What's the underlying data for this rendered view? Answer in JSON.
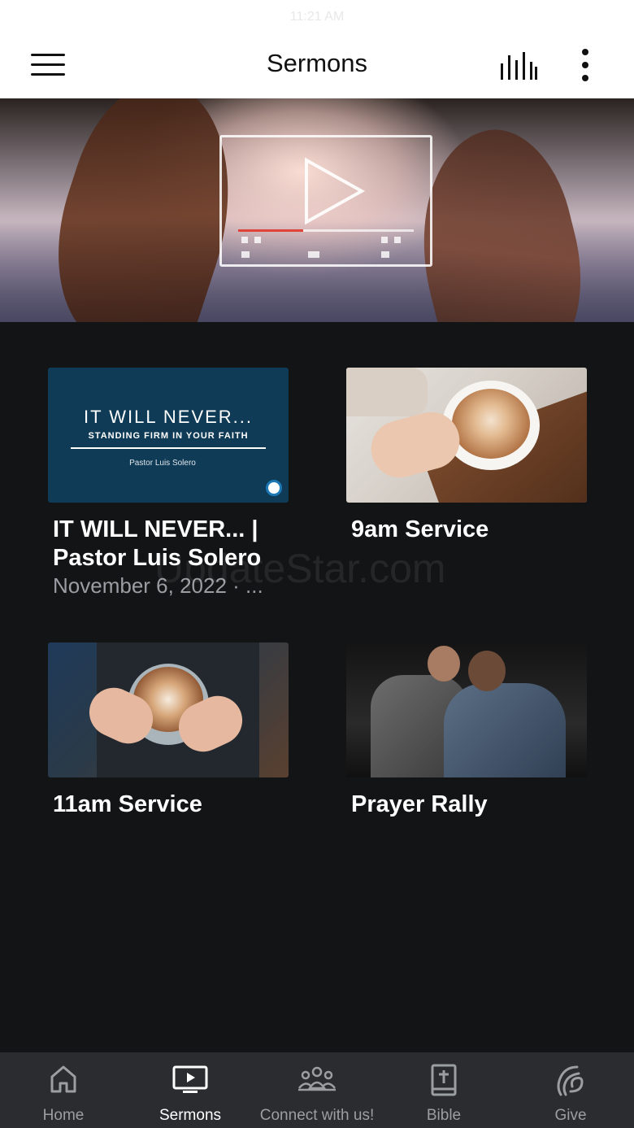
{
  "status_bar": {
    "time": "11:21 AM"
  },
  "header": {
    "title": "Sermons"
  },
  "sermons": [
    {
      "title": "IT WILL NEVER... | Pastor Luis Solero",
      "subtitle": "November 6, 2022 · ...",
      "thumb_text": {
        "headline": "IT WILL NEVER...",
        "tagline": "STANDING FIRM IN YOUR FAITH",
        "speaker": "Pastor Luis Solero"
      }
    },
    {
      "title": "9am Service"
    },
    {
      "title": "11am Service"
    },
    {
      "title": "Prayer Rally"
    }
  ],
  "watermark": "UpdateStar.com",
  "tabs": [
    {
      "label": "Home",
      "icon": "home-icon",
      "active": false
    },
    {
      "label": "Sermons",
      "icon": "tv-play-icon",
      "active": true
    },
    {
      "label": "Connect with us!",
      "icon": "group-icon",
      "active": false
    },
    {
      "label": "Bible",
      "icon": "bible-icon",
      "active": false
    },
    {
      "label": "Give",
      "icon": "give-icon",
      "active": false
    }
  ],
  "colors": {
    "background": "#121416",
    "header_bg": "#ffffff",
    "tabbar_bg": "#2a2c2f",
    "tab_inactive": "#9b9ea2",
    "tab_active": "#ffffff"
  }
}
